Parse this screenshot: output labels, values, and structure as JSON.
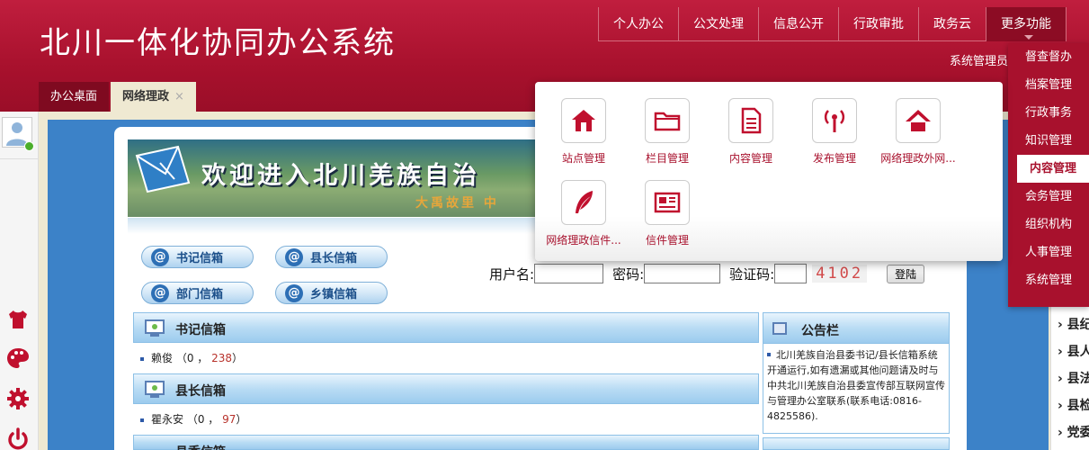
{
  "header": {
    "app_title": "北川一体化协同办公系统",
    "nav": [
      "个人办公",
      "公文处理",
      "信息公开",
      "行政审批",
      "政务云"
    ],
    "more_label": "更多功能",
    "sys_link": "系统管理员"
  },
  "tabs": [
    {
      "label": "办公桌面"
    },
    {
      "label": "网络理政",
      "close": "×"
    }
  ],
  "dropdown": {
    "items": [
      "督查督办",
      "档案管理",
      "行政事务",
      "知识管理",
      "内容管理",
      "会务管理",
      "组织机构",
      "人事管理",
      "系统管理"
    ],
    "active": "内容管理"
  },
  "popup": {
    "apps": [
      {
        "label": "站点管理",
        "icon": "home-icon"
      },
      {
        "label": "栏目管理",
        "icon": "folder-icon"
      },
      {
        "label": "内容管理",
        "icon": "document-icon"
      },
      {
        "label": "发布管理",
        "icon": "broadcast-icon"
      },
      {
        "label": "网络理政外网...",
        "icon": "house-roof-icon"
      },
      {
        "label": "网络理政信件...",
        "icon": "feather-icon"
      },
      {
        "label": "信件管理",
        "icon": "newspaper-icon"
      }
    ]
  },
  "banner": {
    "text": "欢迎进入北川羌族自治",
    "sub": "大禹故里 中"
  },
  "mail_buttons": [
    "书记信箱",
    "县长信箱",
    "部门信箱",
    "乡镇信箱"
  ],
  "login": {
    "username_label": "用户名:",
    "password_label": "密码:",
    "captcha_label": "验证码:",
    "captcha_value": "4102",
    "submit": "登陆"
  },
  "sections": [
    {
      "title": "书记信箱",
      "entry_name": "赖俊",
      "entry_pre": "（0 ，",
      "entry_num": "238",
      "entry_post": "）"
    },
    {
      "title": "县长信箱",
      "entry_name": "瞿永安",
      "entry_pre": "（0 ，",
      "entry_num": "97",
      "entry_post": "）"
    },
    {
      "title": "县委信箱"
    }
  ],
  "notice": {
    "title": "公告栏",
    "body": "北川羌族自治县委书记/县长信箱系统开通运行,如有遗漏或其他问题请及时与中共北川羌族自治县委宣传部互联网宣传与管理办公室联系(联系电话:0816-4825586)."
  },
  "right_list": [
    "县纪",
    "县人",
    "县法",
    "县检",
    "党委"
  ],
  "colors": {
    "brand": "#a8112d",
    "frame": "#3c82c8"
  }
}
